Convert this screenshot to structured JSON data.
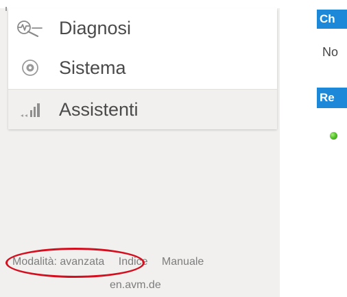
{
  "sidebar": {
    "items": [
      {
        "label": "Diagnosi",
        "icon": "diagnostics-icon"
      },
      {
        "label": "Sistema",
        "icon": "system-icon"
      },
      {
        "label": "Assistenti",
        "icon": "assistants-icon"
      }
    ]
  },
  "footer": {
    "links": [
      "Modalità: avanzata",
      "Indice",
      "Manuale"
    ],
    "domain": "en.avm.de"
  },
  "right_panel": {
    "section_1_label": "Ch",
    "section_1_text": "No",
    "section_2_label": "Re"
  },
  "colors": {
    "accent_blue": "#1e88d8",
    "annotation_red": "#d30f1f",
    "status_green": "#56c529",
    "sidebar_bg": "#f1f0ee"
  }
}
